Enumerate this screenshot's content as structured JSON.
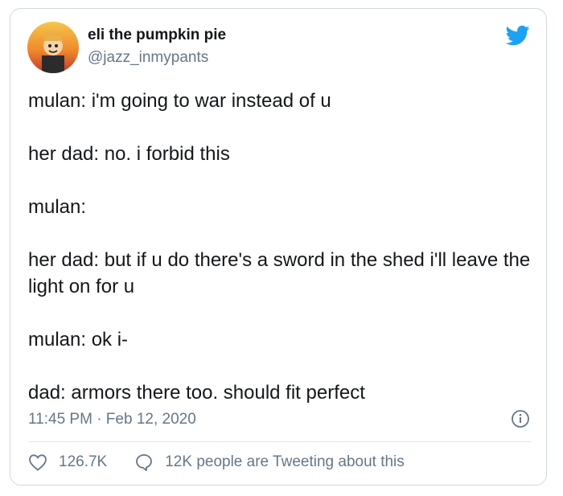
{
  "tweet": {
    "display_name": "eli the pumpkin pie",
    "handle": "@jazz_inmypants",
    "lines": [
      "mulan: i'm going to war instead of u",
      "her dad: no. i forbid this",
      "mulan:",
      "her dad: but if u do there's a sword in the shed i'll leave the light on for u",
      "mulan: ok i-",
      "dad: armors there too. should fit perfect"
    ],
    "timestamp": "11:45 PM · Feb 12, 2020",
    "like_count": "126.7K",
    "reply_text": "12K people are Tweeting about this"
  },
  "colors": {
    "twitter_blue": "#1da1f2",
    "text_primary": "#14171a",
    "text_secondary": "#657786",
    "border": "#cfd9de"
  },
  "icons": {
    "brand": "twitter-bird-icon",
    "info": "info-icon",
    "like": "heart-icon",
    "reply": "speech-bubble-icon"
  }
}
